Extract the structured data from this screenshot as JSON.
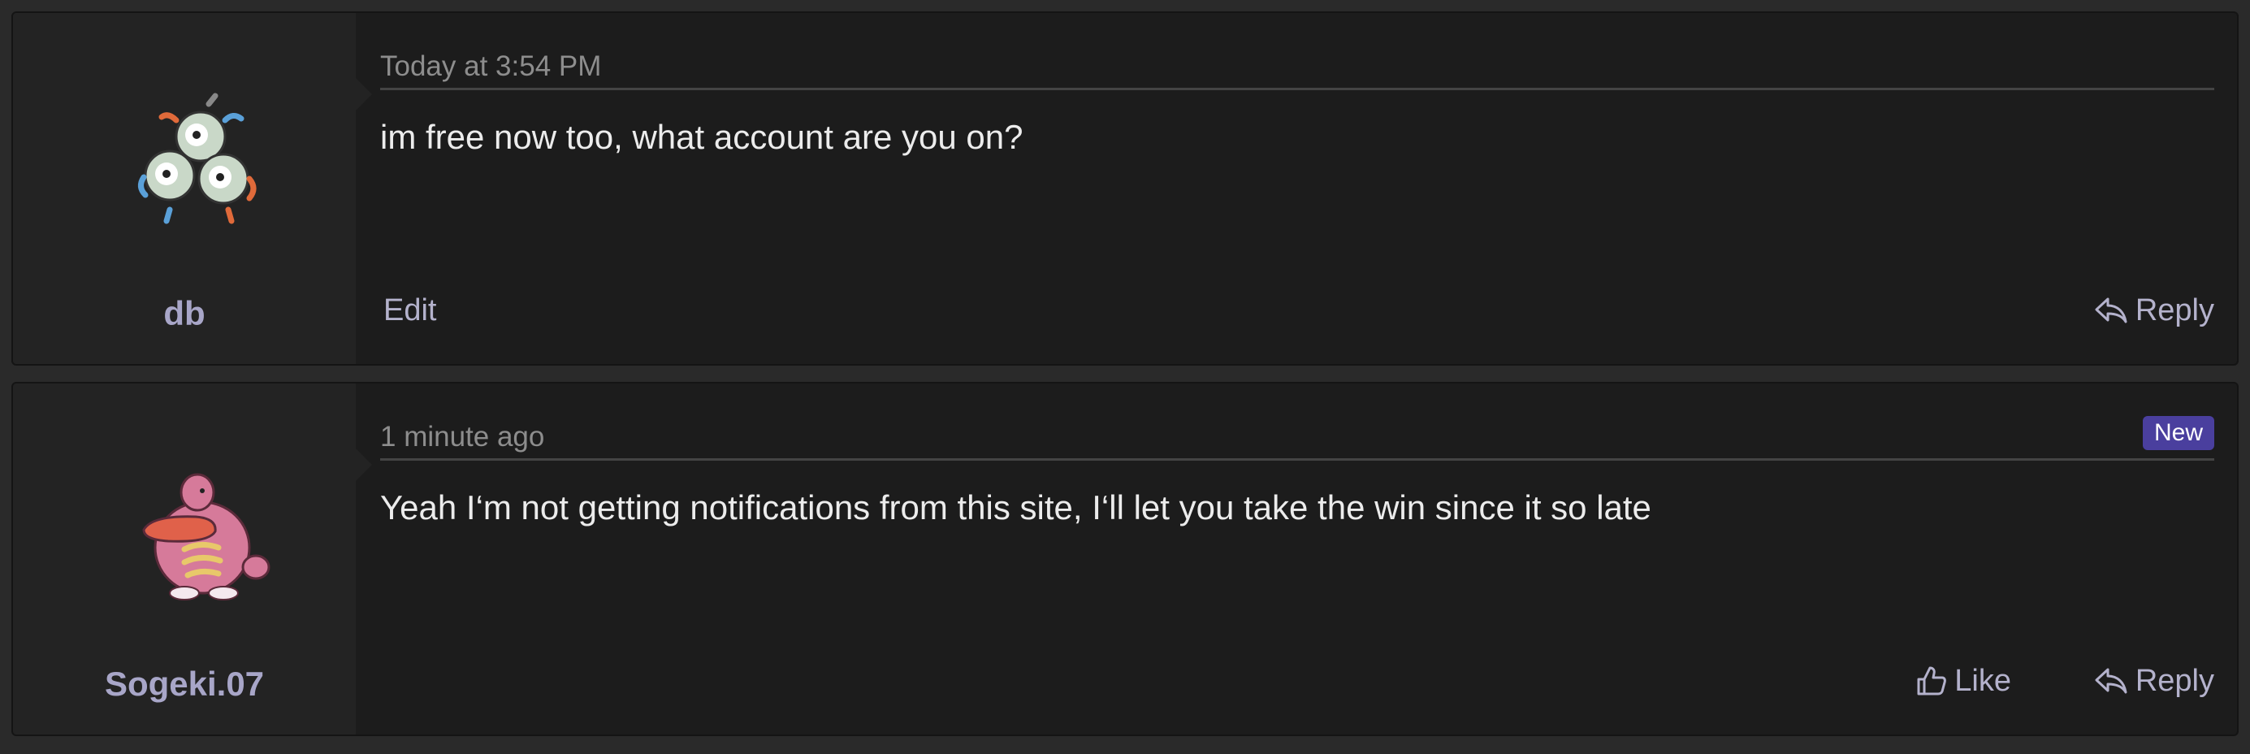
{
  "posts": [
    {
      "username": "db",
      "avatar": "magneton-sprite",
      "timestamp": "Today at 3:54 PM",
      "message": "im free now too, what account are you on?",
      "actions": {
        "edit": "Edit",
        "reply": "Reply"
      }
    },
    {
      "username": "Sogeki.07",
      "avatar": "lickitung-sprite",
      "timestamp": "1 minute ago",
      "badge": "New",
      "message": "Yeah I‘m not getting notifications from this site, I‘ll let you take the win since it so late",
      "actions": {
        "like": "Like",
        "reply": "Reply"
      }
    }
  ],
  "colors": {
    "background": "#2a2a2a",
    "post_background": "#1c1c1c",
    "user_cell": "#232323",
    "username": "#a8a6c8",
    "badge": "#4a3f9e",
    "action_text": "#b4b2cc"
  }
}
